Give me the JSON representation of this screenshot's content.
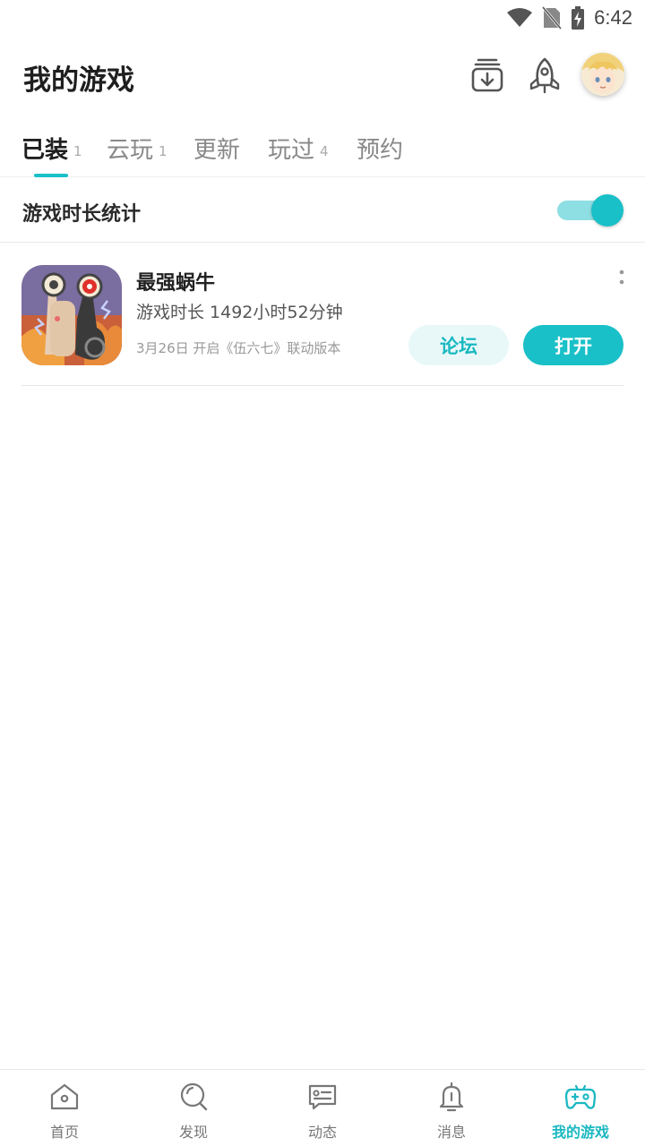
{
  "status_bar": {
    "time": "6:42",
    "icons": [
      "wifi-icon",
      "no-sim-icon",
      "battery-charging-icon"
    ]
  },
  "header": {
    "title": "我的游戏",
    "actions": [
      "download-manager-icon",
      "rocket-icon",
      "avatar"
    ]
  },
  "tabs": [
    {
      "label": "已装",
      "count": "1",
      "active": true
    },
    {
      "label": "云玩",
      "count": "1",
      "active": false
    },
    {
      "label": "更新",
      "count": "",
      "active": false
    },
    {
      "label": "玩过",
      "count": "4",
      "active": false
    },
    {
      "label": "预约",
      "count": "",
      "active": false
    }
  ],
  "playtime_stats": {
    "label": "游戏时长统计",
    "enabled": true
  },
  "games": [
    {
      "name": "最强蜗牛",
      "playtime": "游戏时长 1492小时52分钟",
      "news": "3月26日 开启《伍六七》联动版本",
      "forum_label": "论坛",
      "open_label": "打开",
      "icon": "snail-game-icon"
    }
  ],
  "bottom_nav": [
    {
      "label": "首页",
      "icon": "home-icon",
      "active": false
    },
    {
      "label": "发现",
      "icon": "discover-icon",
      "active": false
    },
    {
      "label": "动态",
      "icon": "feed-icon",
      "active": false
    },
    {
      "label": "消息",
      "icon": "bell-icon",
      "active": false
    },
    {
      "label": "我的游戏",
      "icon": "gamepad-icon",
      "active": true
    }
  ],
  "colors": {
    "accent": "#1ac0c8",
    "accent_light": "#e8f8f9",
    "text_primary": "#222222",
    "text_secondary": "#888888"
  }
}
